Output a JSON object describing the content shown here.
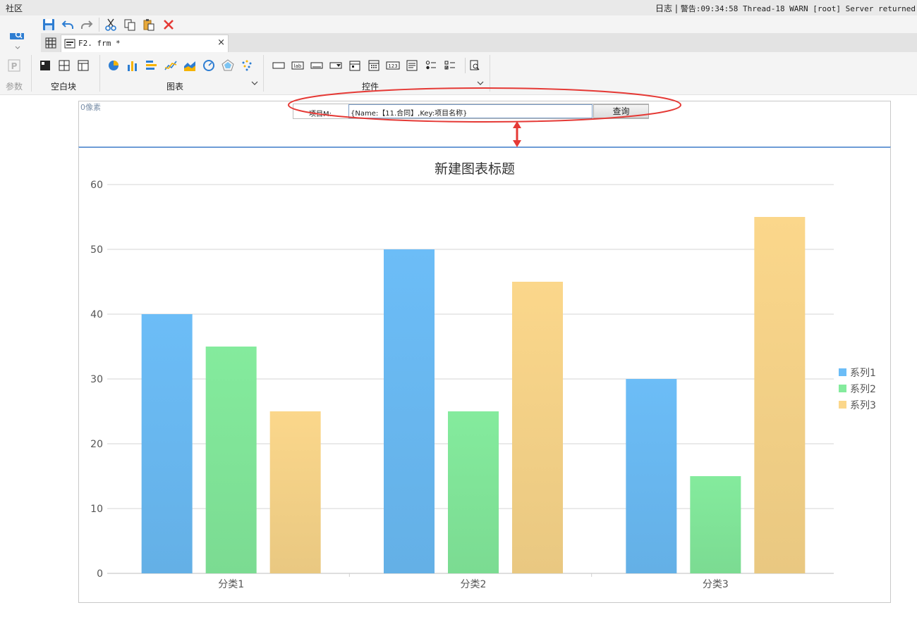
{
  "menubar": {
    "community": "社区",
    "log": "日志",
    "separator": "|",
    "warning": "警告:09:34:58 Thread-18 WARN [root] Server returned"
  },
  "toolbar": {
    "icons": [
      "save-icon",
      "undo-icon",
      "redo-icon",
      "cut-icon",
      "copy-icon",
      "paste-icon",
      "delete-icon"
    ]
  },
  "tabs": {
    "active_label": "F2. frm *",
    "close": "×"
  },
  "ribbon": {
    "param_label": "参数",
    "blank_block_label": "空白块",
    "chart_label": "图表",
    "controls_label": "控件",
    "control_icon_texts": {
      "lab": "lab",
      "num": "123"
    }
  },
  "canvas": {
    "pixel_label": "0像素",
    "param": {
      "label": "项目M:",
      "value": "{Name:【11.合同】,Key:项目名称}",
      "query_button": "查询"
    }
  },
  "colors": {
    "series1": "#6cbdf7",
    "series2": "#84eb9d",
    "series3": "#fbd78b",
    "annotation": "#e53935",
    "chart_top_border": "#6d9cd6"
  },
  "chart_data": {
    "type": "bar",
    "title": "新建图表标题",
    "categories": [
      "分类1",
      "分类2",
      "分类3"
    ],
    "series": [
      {
        "name": "系列1",
        "values": [
          40,
          50,
          30
        ]
      },
      {
        "name": "系列2",
        "values": [
          35,
          25,
          15
        ]
      },
      {
        "name": "系列3",
        "values": [
          25,
          45,
          55
        ]
      }
    ],
    "ylim": [
      0,
      60
    ],
    "yticks": [
      0,
      10,
      20,
      30,
      40,
      50,
      60
    ],
    "grid": true,
    "legend": "right"
  }
}
